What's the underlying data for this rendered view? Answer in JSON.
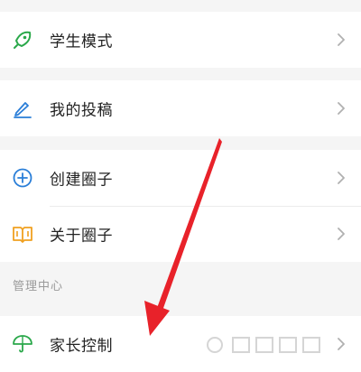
{
  "menu_groups": [
    {
      "items": [
        {
          "label": "学生模式",
          "icon": "rocket-icon"
        }
      ]
    },
    {
      "items": [
        {
          "label": "我的投稿",
          "icon": "pencil-icon"
        }
      ]
    },
    {
      "items": [
        {
          "label": "创建圈子",
          "icon": "plus-circle-icon"
        },
        {
          "label": "关于圈子",
          "icon": "book-icon"
        }
      ]
    }
  ],
  "section": {
    "title": "管理中心",
    "items": [
      {
        "label": "家长控制",
        "icon": "umbrella-icon"
      }
    ]
  },
  "colors": {
    "rocket": "#2aa84a",
    "pencil": "#2a7ed8",
    "plus_circle": "#2a7ed8",
    "book": "#f0a020",
    "umbrella": "#2aa84a",
    "arrow": "#e8222a"
  }
}
